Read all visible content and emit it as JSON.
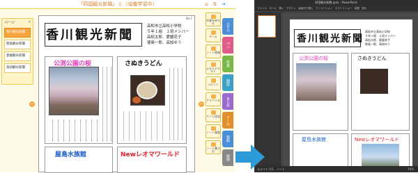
{
  "left_app": {
    "title_prefix": "「四国観光新聞」",
    "title_status": "（協働学習中）",
    "page_panel_label": "ページ",
    "pages": [
      {
        "label": "香川観光新聞",
        "selected": true
      },
      {
        "label": "徳島観光新聞",
        "selected": false
      },
      {
        "label": "愛媛観光新聞",
        "selected": false
      },
      {
        "label": "高知観光新聞",
        "selected": false
      }
    ],
    "paper": {
      "page_number": "No.1",
      "title": "香川観光新聞",
      "info_lines": [
        "高松市立高松小学校",
        "５年１組　１班メンバー",
        "高松太郎、愛媛花子",
        "徳島一郎、高知ゆう"
      ],
      "articles": [
        {
          "title": "公渕公園の桜",
          "color": "#e040c0"
        },
        {
          "title": "さぬきうどん",
          "color": "#111111"
        },
        {
          "title": "屋島水族館",
          "color": "#1a5cc8"
        },
        {
          "title": "Newレオマワールド",
          "color": "#e0202a"
        }
      ]
    },
    "tools": [
      {
        "label": "作業を終わる"
      },
      {
        "label": "ホーム"
      },
      {
        "label": "ノート情報"
      },
      {
        "label": "ふせんテキスト"
      },
      {
        "label": "コメント"
      },
      {
        "label": "アドバイス"
      },
      {
        "label": "ページ追加"
      },
      {
        "label": "ノート複製"
      },
      {
        "label": "ノート書き出"
      }
    ],
    "side_tabs": [
      {
        "label": "ふせん",
        "color": "#4a8fd8"
      },
      {
        "label": "ペン",
        "color": "#e05a8a"
      },
      {
        "label": "写真",
        "color": "#7ab648"
      },
      {
        "label": "図形",
        "color": "#3aa0c8"
      },
      {
        "label": "まとめ",
        "color": "#9a6ad0"
      },
      {
        "label": "ツール",
        "color": "#e0902a"
      },
      {
        "label": "資料",
        "color": "#4a8fd8"
      },
      {
        "label": "削除",
        "color": "#888888"
      }
    ]
  },
  "right_app": {
    "window_title": "四国観光新聞.pptx - PowerPoint",
    "ribbon": "ファイル　ホーム　挿入　デザイン　画面切り替え　アニメーション　スライドショー　校閲　表示",
    "status": "スライド 1/1　ノート",
    "zoom": "76%",
    "paper": {
      "title": "香川観光新聞",
      "info_lines": [
        "高松市立高松小学校",
        "５年１組　１班メンバー",
        "高松太郎、愛媛花子",
        "徳島一郎、高知ゆう"
      ],
      "articles": [
        {
          "title": "公渕公園の桜",
          "color": "#e040c0"
        },
        {
          "title": "さぬきうどん",
          "color": "#111111"
        },
        {
          "title": "屋島水族館",
          "color": "#1a5cc8"
        },
        {
          "title": "Newレオマワールド",
          "color": "#e0202a"
        }
      ]
    }
  },
  "colors": {
    "accent_orange": "#f6a640",
    "arrow_blue": "#2e9ad8"
  }
}
